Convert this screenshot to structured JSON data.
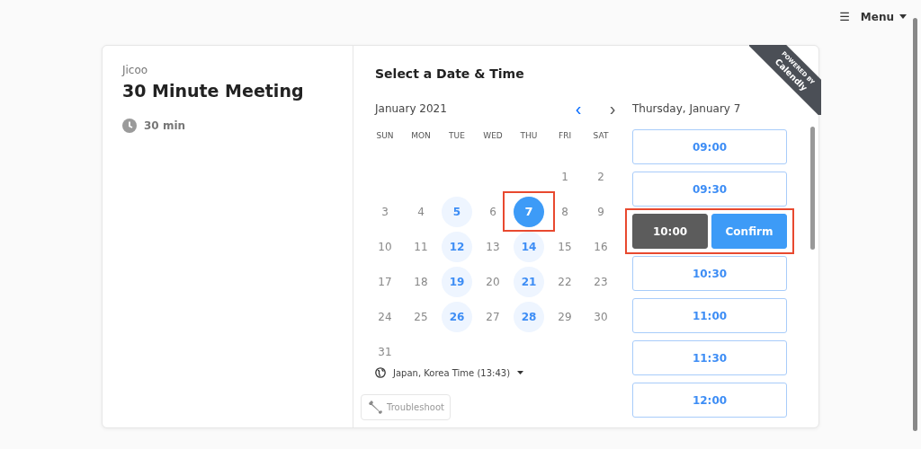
{
  "menu": {
    "icon": "☰",
    "label": "Menu"
  },
  "event": {
    "organizer": "Jicoo",
    "title": "30 Minute Meeting",
    "duration": "30 min"
  },
  "ribbon": {
    "top": "POWERED BY",
    "brand": "Calendly"
  },
  "heading": "Select a Date & Time",
  "calendar": {
    "month": "January 2021",
    "prev": "‹",
    "next": "›",
    "weekdays": [
      "SUN",
      "MON",
      "TUE",
      "WED",
      "THU",
      "FRI",
      "SAT"
    ],
    "weeks": [
      [
        {
          "kind": "blank"
        },
        {
          "kind": "blank"
        },
        {
          "kind": "blank"
        },
        {
          "kind": "blank"
        },
        {
          "kind": "blank"
        },
        {
          "kind": "day",
          "day": "1",
          "available": false
        },
        {
          "kind": "day",
          "day": "2",
          "available": false
        }
      ],
      [
        {
          "kind": "day",
          "day": "3",
          "available": false
        },
        {
          "kind": "day",
          "day": "4",
          "available": false
        },
        {
          "kind": "day",
          "day": "5",
          "available": true,
          "selected": false
        },
        {
          "kind": "day",
          "day": "6",
          "available": false
        },
        {
          "kind": "day",
          "day": "7",
          "available": true,
          "selected": true,
          "highlighted": true
        },
        {
          "kind": "day",
          "day": "8",
          "available": false
        },
        {
          "kind": "day",
          "day": "9",
          "available": false
        }
      ],
      [
        {
          "kind": "day",
          "day": "10",
          "available": false
        },
        {
          "kind": "day",
          "day": "11",
          "available": false
        },
        {
          "kind": "day",
          "day": "12",
          "available": true,
          "selected": false
        },
        {
          "kind": "day",
          "day": "13",
          "available": false
        },
        {
          "kind": "day",
          "day": "14",
          "available": true,
          "selected": false
        },
        {
          "kind": "day",
          "day": "15",
          "available": false
        },
        {
          "kind": "day",
          "day": "16",
          "available": false
        }
      ],
      [
        {
          "kind": "day",
          "day": "17",
          "available": false
        },
        {
          "kind": "day",
          "day": "18",
          "available": false
        },
        {
          "kind": "day",
          "day": "19",
          "available": true,
          "selected": false
        },
        {
          "kind": "day",
          "day": "20",
          "available": false
        },
        {
          "kind": "day",
          "day": "21",
          "available": true,
          "selected": false
        },
        {
          "kind": "day",
          "day": "22",
          "available": false
        },
        {
          "kind": "day",
          "day": "23",
          "available": false
        }
      ],
      [
        {
          "kind": "day",
          "day": "24",
          "available": false
        },
        {
          "kind": "day",
          "day": "25",
          "available": false
        },
        {
          "kind": "day",
          "day": "26",
          "available": true,
          "selected": false
        },
        {
          "kind": "day",
          "day": "27",
          "available": false
        },
        {
          "kind": "day",
          "day": "28",
          "available": true,
          "selected": false
        },
        {
          "kind": "day",
          "day": "29",
          "available": false
        },
        {
          "kind": "day",
          "day": "30",
          "available": false
        }
      ],
      [
        {
          "kind": "day",
          "day": "31",
          "available": false
        }
      ]
    ]
  },
  "timezone": {
    "label": "Japan, Korea Time (13:43)"
  },
  "troubleshoot": "Troubleshoot",
  "selected_date": "Thursday, January 7",
  "slots": [
    {
      "time": "09:00",
      "selected": false
    },
    {
      "time": "09:30",
      "selected": false
    },
    {
      "time": "10:00",
      "selected": true,
      "highlighted": true,
      "confirm": "Confirm"
    },
    {
      "time": "10:30",
      "selected": false
    },
    {
      "time": "11:00",
      "selected": false
    },
    {
      "time": "11:30",
      "selected": false
    },
    {
      "time": "12:00",
      "selected": false
    }
  ]
}
